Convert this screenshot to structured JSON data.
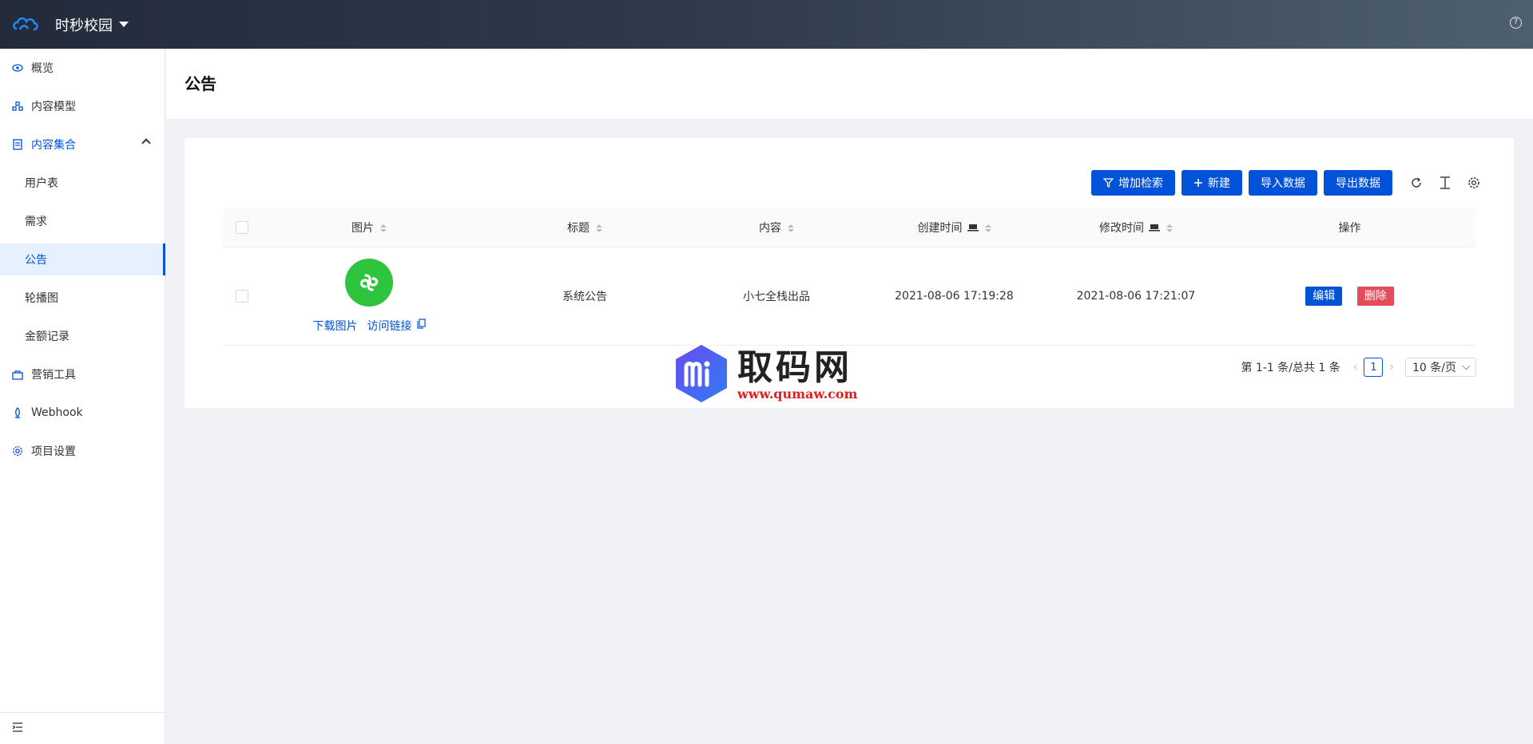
{
  "header": {
    "project_name": "时秒校园",
    "help_icon": "help-icon"
  },
  "sidebar": {
    "items": [
      {
        "label": "概览",
        "icon": "eye-icon"
      },
      {
        "label": "内容模型",
        "icon": "model-icon"
      },
      {
        "label": "内容集合",
        "icon": "collection-icon",
        "expanded": true
      },
      {
        "label": "用户表"
      },
      {
        "label": "需求"
      },
      {
        "label": "公告",
        "active": true
      },
      {
        "label": "轮播图"
      },
      {
        "label": "金额记录"
      },
      {
        "label": "营销工具",
        "icon": "marketing-icon"
      },
      {
        "label": "Webhook",
        "icon": "webhook-icon"
      },
      {
        "label": "项目设置",
        "icon": "settings-icon"
      }
    ]
  },
  "page": {
    "title": "公告"
  },
  "toolbar": {
    "add_filter": "增加检索",
    "create": "新建",
    "import": "导入数据",
    "export": "导出数据"
  },
  "table": {
    "columns": [
      "图片",
      "标题",
      "内容",
      "创建时间",
      "修改时间",
      "操作"
    ],
    "rows": [
      {
        "title": "系统公告",
        "content": "小七全栈出品",
        "created": "2021-08-06 17:19:28",
        "modified": "2021-08-06 17:21:07",
        "download_link": "下载图片",
        "visit_link": "访问链接"
      }
    ],
    "edit_label": "编辑",
    "delete_label": "删除"
  },
  "pagination": {
    "summary": "第 1-1 条/总共 1 条",
    "current_page": "1",
    "page_size": "10 条/页"
  },
  "watermark": {
    "title": "取码网",
    "url": "www.qumaw.com"
  },
  "colors": {
    "primary": "#0052d9",
    "danger": "#e34d59",
    "header_start": "#232b3b",
    "header_end": "#4e6070"
  }
}
